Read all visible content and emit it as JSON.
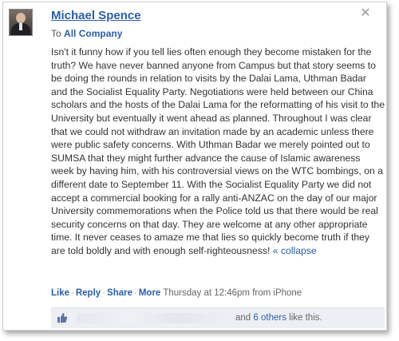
{
  "post": {
    "author": "Michael Spence",
    "audience_prefix": "To",
    "audience_group": "All Company",
    "message": "Isn't it funny how if you tell lies often enough they become mistaken for the truth? We have never banned anyone from Campus but that story seems to be doing the rounds in relation to visits by the Dalai Lama, Uthman Badar and the Socialist Equality Party. Negotiations were held between our China scholars and the hosts of the Dalai Lama for the reformatting of his visit to the University but eventually it went ahead as planned. Throughout I was clear that we could not withdraw an invitation made by an academic unless there were public safety concerns. With Uthman Badar we merely pointed out to SUMSA that they might further advance the cause of Islamic awareness week by having him, with his controversial views on the WTC bombings, on a different date to September 11. With the Socialist Equality Party we did not accept a commercial booking for a rally anti-ANZAC on the day of our major University commemorations when the Police told us that there would be real security concerns on that day. They are welcome at any other appropriate time. It never ceases to amaze me that lies so quickly become truth if they are told boldly and with enough self-righteousness!",
    "collapse_label": "« collapse",
    "close_icon": "close-icon",
    "avatar_icon": "profile-photo"
  },
  "actions": {
    "like": "Like",
    "reply": "Reply",
    "share": "Share",
    "more": "More",
    "timestamp": "Thursday at 12:46pm from iPhone"
  },
  "likes": {
    "icon": "thumbs-up-icon",
    "prefix": "and",
    "others_link": "6 others",
    "suffix": "like this."
  },
  "colors": {
    "link": "#2a5fa6",
    "likebar_bg": "#edeff4",
    "text": "#333333"
  }
}
